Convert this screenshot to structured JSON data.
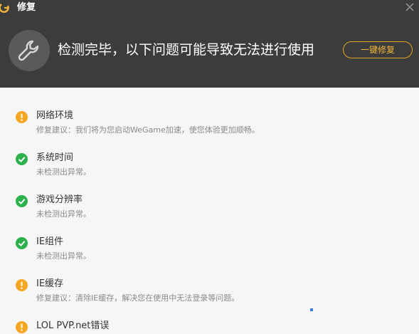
{
  "window": {
    "title": "修复",
    "close_glyph": "✕"
  },
  "header": {
    "headline": "检测完毕，以下问题可能导致无法进行使用",
    "fix_button_label": "一键修复",
    "tool_icon": "wrench-icon"
  },
  "colors": {
    "header_bg": "#3c3c3c",
    "accent": "#e2a427",
    "warning": "#f5a623",
    "ok": "#2bb24c"
  },
  "items": [
    {
      "title": "网络环境",
      "desc": "修复建议：我们将为您启动WeGame加速，使您体验更加顺畅。",
      "status": "warning"
    },
    {
      "title": "系统时间",
      "desc": "未检测出异常。",
      "status": "ok"
    },
    {
      "title": "游戏分辨率",
      "desc": "未检测出异常。",
      "status": "ok"
    },
    {
      "title": "IE组件",
      "desc": "未检测出异常。",
      "status": "ok"
    },
    {
      "title": "IE缓存",
      "desc": "修复建议：清除IE缓存，解决您在使用中无法登录等问题。",
      "status": "warning"
    },
    {
      "title": "LOL PVP.net错误",
      "desc": "",
      "status": "warning"
    }
  ]
}
